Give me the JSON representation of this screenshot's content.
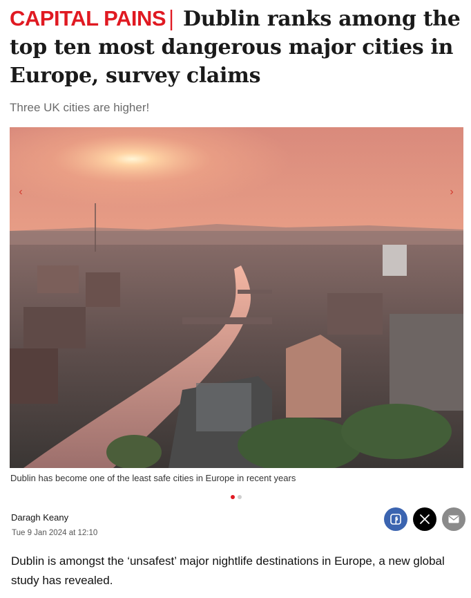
{
  "article": {
    "kicker": "CAPITAL PAINS",
    "separator": "|",
    "headline": "Dublin ranks among the top ten most dangerous major cities in Europe, survey claims",
    "subhead": "Three UK cities are higher!",
    "image_caption": "Dublin has become one of the least safe cities in Europe in recent years",
    "author": "Daragh Keany",
    "date": "Tue 9 Jan 2024 at 12:10",
    "body_first_paragraph": "Dublin is amongst the ‘unsafest’ major nightlife destinations in Europe, a new global study has revealed."
  },
  "gallery": {
    "slides_total": 2,
    "active_slide": 1,
    "prev_icon": "chevron-left-icon",
    "next_icon": "chevron-right-icon"
  },
  "share": {
    "facebook_icon": "facebook-icon",
    "x_icon": "x-icon",
    "email_icon": "email-icon"
  },
  "colors": {
    "brand_red": "#e01a22",
    "facebook_blue": "#3b64b0",
    "x_black": "#000000",
    "email_gray": "#8a8a8a"
  }
}
